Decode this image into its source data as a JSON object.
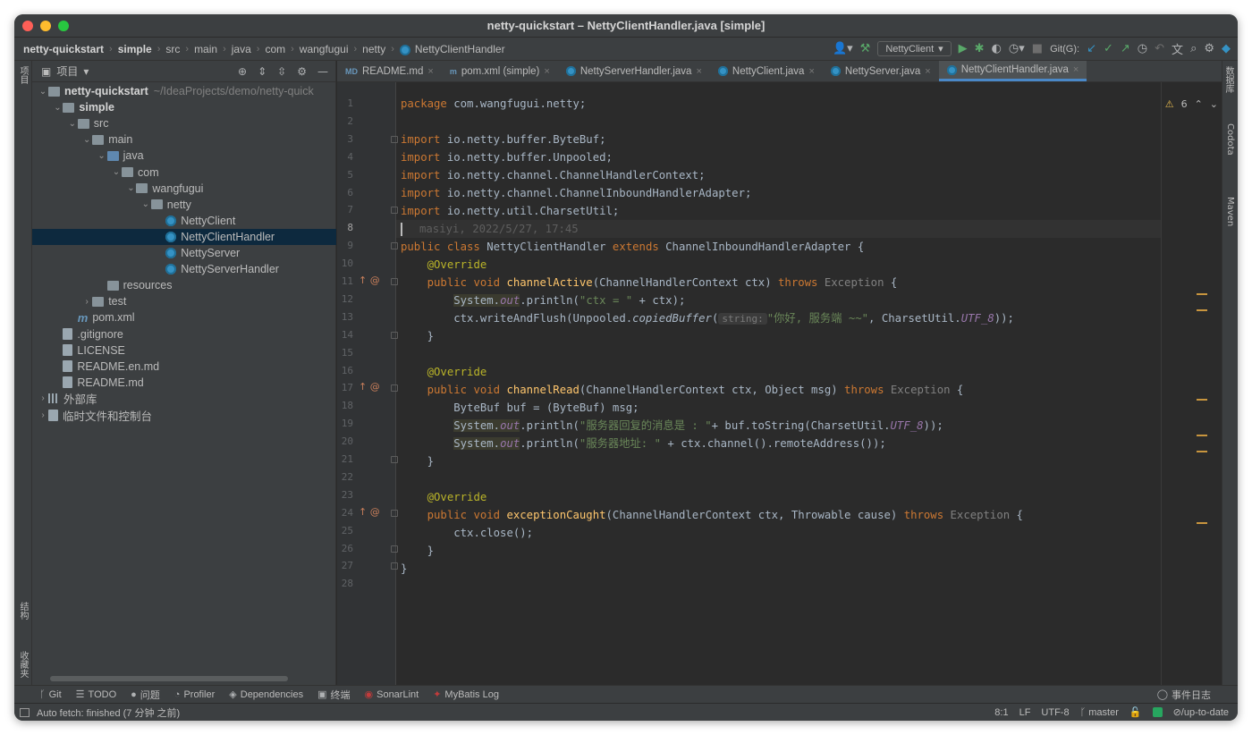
{
  "window": {
    "title": "netty-quickstart – NettyClientHandler.java [simple]"
  },
  "breadcrumb": [
    "netty-quickstart",
    "simple",
    "src",
    "main",
    "java",
    "com",
    "wangfugui",
    "netty",
    "NettyClientHandler"
  ],
  "toolbar": {
    "run_config": "NettyClient",
    "git_label": "Git(G):"
  },
  "left_strip": {
    "project_tab": "项目",
    "structure_tab": "结构",
    "favorites_tab": "收藏夹"
  },
  "right_strip": {
    "database_tab": "数据库",
    "codota_tab": "Codota",
    "maven_tab": "Maven"
  },
  "project": {
    "header": "项目",
    "tree": [
      {
        "label": "netty-quickstart",
        "extra": "~/IdeaProjects/demo/netty-quick",
        "depth": 0,
        "arrow": "v",
        "icon": "module-folder",
        "bold": true
      },
      {
        "label": "simple",
        "depth": 1,
        "arrow": "v",
        "icon": "module-folder",
        "bold": true
      },
      {
        "label": "src",
        "depth": 2,
        "arrow": "v",
        "icon": "folder"
      },
      {
        "label": "main",
        "depth": 3,
        "arrow": "v",
        "icon": "folder"
      },
      {
        "label": "java",
        "depth": 4,
        "arrow": "v",
        "icon": "source-folder"
      },
      {
        "label": "com",
        "depth": 5,
        "arrow": "v",
        "icon": "package"
      },
      {
        "label": "wangfugui",
        "depth": 6,
        "arrow": "v",
        "icon": "package"
      },
      {
        "label": "netty",
        "depth": 7,
        "arrow": "v",
        "icon": "package"
      },
      {
        "label": "NettyClient",
        "depth": 8,
        "arrow": "",
        "icon": "class"
      },
      {
        "label": "NettyClientHandler",
        "depth": 8,
        "arrow": "",
        "icon": "class",
        "selected": true
      },
      {
        "label": "NettyServer",
        "depth": 8,
        "arrow": "",
        "icon": "class"
      },
      {
        "label": "NettyServerHandler",
        "depth": 8,
        "arrow": "",
        "icon": "class"
      },
      {
        "label": "resources",
        "depth": 4,
        "arrow": "",
        "icon": "resource-folder"
      },
      {
        "label": "test",
        "depth": 3,
        "arrow": ">",
        "icon": "folder"
      },
      {
        "label": "pom.xml",
        "depth": 2,
        "arrow": "",
        "icon": "maven"
      },
      {
        "label": ".gitignore",
        "depth": 1,
        "arrow": "",
        "icon": "file"
      },
      {
        "label": "LICENSE",
        "depth": 1,
        "arrow": "",
        "icon": "file"
      },
      {
        "label": "README.en.md",
        "depth": 1,
        "arrow": "",
        "icon": "markdown"
      },
      {
        "label": "README.md",
        "depth": 1,
        "arrow": "",
        "icon": "markdown"
      },
      {
        "label": "外部库",
        "depth": 0,
        "arrow": ">",
        "icon": "library"
      },
      {
        "label": "临时文件和控制台",
        "depth": 0,
        "arrow": ">",
        "icon": "scratch"
      }
    ]
  },
  "tabs": [
    {
      "label": "README.md",
      "icon": "md"
    },
    {
      "label": "pom.xml (simple)",
      "icon": "maven"
    },
    {
      "label": "NettyServerHandler.java",
      "icon": "class"
    },
    {
      "label": "NettyClient.java",
      "icon": "class"
    },
    {
      "label": "NettyServer.java",
      "icon": "class"
    },
    {
      "label": "NettyClientHandler.java",
      "icon": "class",
      "active": true
    }
  ],
  "editor": {
    "warnings": "6",
    "line_count": 28,
    "current_line": 8,
    "blame": "masiyi, 2022/5/27, 17:45",
    "lines": {
      "l1_a": "package",
      "l1_b": " com.wangfugui.netty;",
      "l3_b": " io.netty.buffer.ByteBuf;",
      "l4_b": " io.netty.buffer.Unpooled;",
      "l5_b": " io.netty.channel.ChannelHandlerContext;",
      "l6_b": " io.netty.channel.ChannelInboundHandlerAdapter;",
      "l7_b": " io.netty.util.CharsetUtil;",
      "import": "import",
      "l9_a": "public class",
      "l9_b": " NettyClientHandler ",
      "l9_c": "extends",
      "l9_d": " ChannelInboundHandlerAdapter {",
      "override": "@Override",
      "public_void": "public void ",
      "throws": "throws",
      "exception": " Exception",
      "l11_fn": "channelActive",
      "l11_args": "(ChannelHandlerContext ctx) ",
      "l12_sys": "System.",
      "l12_out": "out",
      "l12_b": ".println(",
      "l12_str": "\"ctx = \"",
      "l12_c": " + ctx);",
      "l13_a": "ctx.writeAndFlush(Unpooled.",
      "l13_fn": "copiedBuffer",
      "l13_b": "(",
      "l13_hint": "string:",
      "l13_str": "\"你好, 服务端 ~~\"",
      "l13_c": ", CharsetUtil.",
      "l13_fld": "UTF_8",
      "l13_d": "));",
      "l17_fn": "channelRead",
      "l17_args": "(ChannelHandlerContext ctx, Object msg) ",
      "l18": "ByteBuf buf = (ByteBuf) msg;",
      "l19_str": "\"服务器回复的消息是 : \"",
      "l19_c": "+ buf.toString(CharsetUtil.",
      "l19_d": "));",
      "l20_str": "\"服务器地址: \"",
      "l20_c": " + ctx.channel().remoteAddress());",
      "l24_fn": "exceptionCaught",
      "l24_args": "(ChannelHandlerContext ctx, Throwable cause) ",
      "l25": "ctx.close();",
      "close_brace": "}",
      "open_brace": " {"
    }
  },
  "bottom_tools": [
    "Git",
    "TODO",
    "问题",
    "Profiler",
    "Dependencies",
    "终端",
    "SonarLint",
    "MyBatis Log"
  ],
  "event_log": "事件日志",
  "status": {
    "message": "Auto fetch: finished (7 分钟 之前)",
    "position": "8:1",
    "line_sep": "LF",
    "encoding": "UTF-8",
    "branch": "master",
    "vcs_state": "⊘/up-to-date"
  }
}
